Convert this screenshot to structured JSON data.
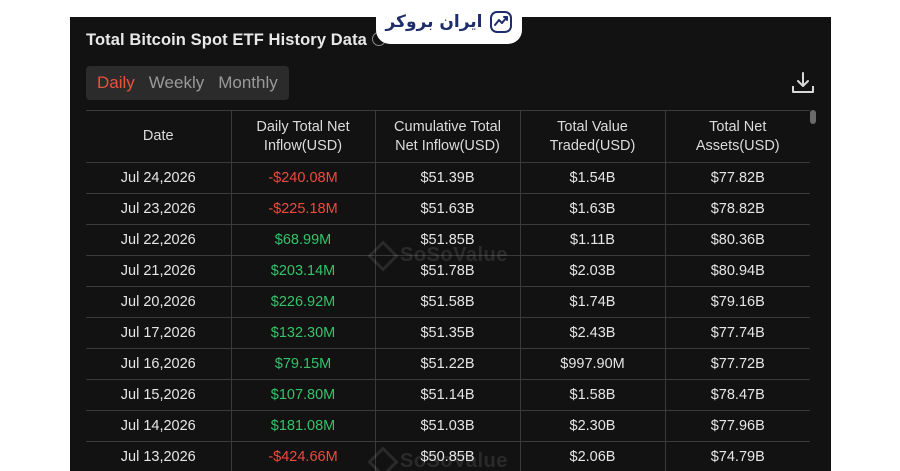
{
  "panel": {
    "title": "Total Bitcoin Spot ETF History Data"
  },
  "logo": {
    "text": "ایران بروکر"
  },
  "tabs": [
    {
      "label": "Daily",
      "active": true
    },
    {
      "label": "Weekly",
      "active": false
    },
    {
      "label": "Monthly",
      "active": false
    }
  ],
  "watermark": "SoSoValue",
  "colors": {
    "negative": "#ef4a3a",
    "positive": "#35c26b",
    "active_tab": "#e5533d"
  },
  "icons": {
    "info": "info-icon",
    "download": "download-icon",
    "logo": "ibroker-logo-icon"
  },
  "table": {
    "headers": [
      [
        "Date"
      ],
      [
        "Daily Total Net",
        "Inflow(USD)"
      ],
      [
        "Cumulative Total",
        "Net Inflow(USD)"
      ],
      [
        "Total Value",
        "Traded(USD)"
      ],
      [
        "Total Net",
        "Assets(USD)"
      ]
    ],
    "rows": [
      {
        "date": "Jul 24,2026",
        "daily": "-$240.08M",
        "sign": "neg",
        "cumulative": "$51.39B",
        "traded": "$1.54B",
        "assets": "$77.82B"
      },
      {
        "date": "Jul 23,2026",
        "daily": "-$225.18M",
        "sign": "neg",
        "cumulative": "$51.63B",
        "traded": "$1.63B",
        "assets": "$78.82B"
      },
      {
        "date": "Jul 22,2026",
        "daily": "$68.99M",
        "sign": "pos",
        "cumulative": "$51.85B",
        "traded": "$1.11B",
        "assets": "$80.36B"
      },
      {
        "date": "Jul 21,2026",
        "daily": "$203.14M",
        "sign": "pos",
        "cumulative": "$51.78B",
        "traded": "$2.03B",
        "assets": "$80.94B"
      },
      {
        "date": "Jul 20,2026",
        "daily": "$226.92M",
        "sign": "pos",
        "cumulative": "$51.58B",
        "traded": "$1.74B",
        "assets": "$79.16B"
      },
      {
        "date": "Jul 17,2026",
        "daily": "$132.30M",
        "sign": "pos",
        "cumulative": "$51.35B",
        "traded": "$2.43B",
        "assets": "$77.74B"
      },
      {
        "date": "Jul 16,2026",
        "daily": "$79.15M",
        "sign": "pos",
        "cumulative": "$51.22B",
        "traded": "$997.90M",
        "assets": "$77.72B"
      },
      {
        "date": "Jul 15,2026",
        "daily": "$107.80M",
        "sign": "pos",
        "cumulative": "$51.14B",
        "traded": "$1.58B",
        "assets": "$78.47B"
      },
      {
        "date": "Jul 14,2026",
        "daily": "$181.08M",
        "sign": "pos",
        "cumulative": "$51.03B",
        "traded": "$2.30B",
        "assets": "$77.96B"
      },
      {
        "date": "Jul 13,2026",
        "daily": "-$424.66M",
        "sign": "neg",
        "cumulative": "$50.85B",
        "traded": "$2.06B",
        "assets": "$74.79B"
      }
    ]
  }
}
